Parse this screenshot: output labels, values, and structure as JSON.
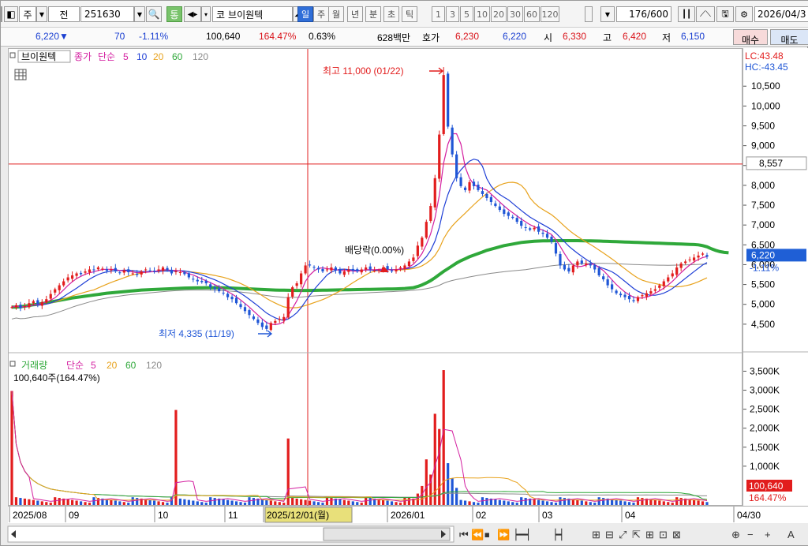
{
  "toolbar": {
    "market": "주",
    "prev_label": "전",
    "code": "251630",
    "name_prefix": "코",
    "stock_name": "브이원텍",
    "periods": [
      "일",
      "주",
      "월",
      "년",
      "분",
      "초",
      "틱"
    ],
    "selected_period": "일",
    "intervals": [
      "1",
      "3",
      "5",
      "10",
      "20",
      "30",
      "60",
      "120"
    ],
    "count": "176",
    "count_total": "/600",
    "date": "2026/04/3"
  },
  "quote": {
    "price": "6,220▼",
    "change": "70",
    "change_pct": "-1.11%",
    "volume": "100,640",
    "volume_pct": "164.47%",
    "turnover": "0.63%",
    "amount": "628백만",
    "bid_label": "호가",
    "ask": "6,230",
    "bid": "6,220",
    "open_label": "시",
    "open": "6,330",
    "high_label": "고",
    "high": "6,420",
    "low_label": "저",
    "low": "6,150",
    "buy_label": "매수",
    "sell_label": "매도"
  },
  "colors": {
    "up": "#e21d1d",
    "down": "#1f56d6",
    "ma5": "#d41fa0",
    "ma10": "#1f3fd6",
    "ma20": "#e8a21c",
    "ma60": "#2fa83a",
    "ma120": "#8a8a8a"
  },
  "chart_data": [
    {
      "type": "candlestick",
      "legend": {
        "name": "브이원텍",
        "price_label": "종가",
        "ma_label": "단순",
        "periods": [
          "5",
          "10",
          "20",
          "60",
          "120"
        ]
      },
      "ylim": [
        4000,
        11300
      ],
      "y_ticks": [
        "4,500",
        "5,000",
        "5,500",
        "6,000",
        "6,500",
        "7,000",
        "7,500",
        "8,000",
        "8,500",
        "9,000",
        "9,500",
        "10,000",
        "10,500"
      ],
      "lc": "LC:43.48",
      "hc": "HC:-43.45",
      "crosshair_price": "8,557",
      "last_price": "6,220",
      "last_change": "-1.11%",
      "annotations": {
        "high": "최고 11,000 (01/22)",
        "low": "최저 4,335 (11/19)",
        "dividend": "배당락(0.00%)"
      },
      "close": [
        4950,
        5000,
        4920,
        4970,
        5050,
        5100,
        5020,
        5080,
        5150,
        5280,
        5400,
        5500,
        5600,
        5700,
        5750,
        5800,
        5780,
        5850,
        5900,
        5880,
        5950,
        5920,
        5870,
        5900,
        5850,
        5820,
        5880,
        5830,
        5800,
        5760,
        5850,
        5900,
        5870,
        5850,
        5900,
        5950,
        5880,
        5800,
        5850,
        5830,
        5780,
        5700,
        5650,
        5600,
        5580,
        5550,
        5450,
        5400,
        5350,
        5300,
        5200,
        5150,
        5050,
        4950,
        4850,
        4750,
        4650,
        4550,
        4450,
        4400,
        4550,
        4600,
        4650,
        4700,
        5200,
        5450,
        5550,
        5800,
        6000,
        6000,
        5950,
        5900,
        5850,
        5900,
        5950,
        5880,
        5800,
        5850,
        5900,
        5870,
        5850,
        5900,
        5950,
        5900,
        5870,
        5880,
        5950,
        5900,
        5850,
        5900,
        5950,
        6000,
        6100,
        6200,
        6500,
        6700,
        7100,
        7500,
        8200,
        9300,
        10800,
        9500,
        8800,
        8200,
        8000,
        7900,
        8100,
        8000,
        7900,
        7800,
        7700,
        7600,
        7500,
        7400,
        7300,
        7250,
        7200,
        7100,
        7000,
        6950,
        6900,
        6950,
        6850,
        6800,
        6700,
        6600,
        6300,
        6000,
        5900,
        5850,
        6000,
        6100,
        6050,
        6050,
        6000,
        5900,
        5750,
        5650,
        5500,
        5400,
        5300,
        5250,
        5200,
        5150,
        5100,
        5200,
        5250,
        5300,
        5350,
        5400,
        5500,
        5600,
        5700,
        5800,
        5950,
        6050,
        6100,
        6150,
        6200,
        6250,
        6300,
        6220
      ],
      "open_gap_pattern": "derived",
      "ma60_values": [
        4950,
        4950,
        4960,
        4975,
        4990,
        5010,
        5020,
        5040,
        5060,
        5080,
        5100,
        5120,
        5140,
        5160,
        5180,
        5195,
        5210,
        5225,
        5240,
        5255,
        5270,
        5285,
        5300,
        5310,
        5320,
        5330,
        5340,
        5350,
        5360,
        5370,
        5380,
        5385,
        5390,
        5395,
        5400,
        5405,
        5410,
        5415,
        5420,
        5425,
        5430,
        5432,
        5434,
        5436,
        5438,
        5440,
        5440,
        5440,
        5438,
        5436,
        5434,
        5430,
        5425,
        5420,
        5415,
        5410,
        5405,
        5400,
        5395,
        5390,
        5385,
        5380,
        5378,
        5376,
        5374,
        5372,
        5370,
        5370,
        5370,
        5370,
        5372,
        5374,
        5376,
        5378,
        5380,
        5382,
        5384,
        5386,
        5388,
        5390,
        5392,
        5394,
        5396,
        5398,
        5400,
        5402,
        5404,
        5406,
        5408,
        5410,
        5415,
        5420,
        5430,
        5440,
        5470,
        5510,
        5560,
        5620,
        5690,
        5770,
        5850,
        5920,
        5990,
        6060,
        6120,
        6170,
        6220,
        6260,
        6300,
        6340,
        6380,
        6410,
        6440,
        6470,
        6500,
        6520,
        6540,
        6560,
        6580,
        6590,
        6600,
        6610,
        6615,
        6620,
        6622,
        6624,
        6625,
        6626,
        6626,
        6626,
        6626,
        6625,
        6624,
        6622,
        6620,
        6618,
        6615,
        6612,
        6608,
        6604,
        6600,
        6596,
        6592,
        6588,
        6584,
        6580,
        6576,
        6572,
        6568,
        6564,
        6560,
        6556,
        6552,
        6548,
        6544,
        6540,
        6536,
        6532,
        6528,
        6520,
        6500,
        6470,
        6420,
        6380,
        6350,
        6330,
        6320
      ]
    },
    {
      "type": "bar",
      "legend": {
        "name": "거래량",
        "ma_label": "단순",
        "periods": [
          "5",
          "20",
          "60",
          "120"
        ]
      },
      "current": "100,640주(164.47%)",
      "ylim": [
        0,
        3800000
      ],
      "y_ticks": [
        "1,000K",
        "1,500K",
        "2,000K",
        "2,500K",
        "3,000K",
        "3,500K"
      ],
      "last_value": "100,640",
      "last_pct": "164.47%"
    }
  ],
  "x_axis": {
    "labels": [
      "2025/08",
      "09",
      "10",
      "11",
      "2025/12/01(월)",
      "2026/01",
      "02",
      "03",
      "04",
      "04/30"
    ]
  }
}
